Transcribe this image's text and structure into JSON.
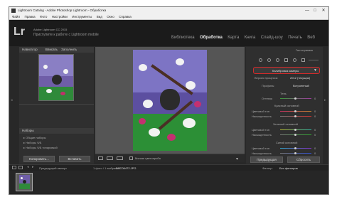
{
  "window": {
    "title": "Lightroom Catalog - Adobe Photoshop Lightroom - Обработка",
    "controls": [
      "—",
      "□",
      "✕"
    ]
  },
  "menu": [
    "Файл",
    "Правка",
    "Фото",
    "Настройки",
    "Инструменты",
    "Вид",
    "Окно",
    "Справка"
  ],
  "header": {
    "logo": "Lr",
    "line1": "Adobe Lightroom CC 2015",
    "line2": "Приступите к работе с Lightroom mobile",
    "modules": [
      "Библиотека",
      "Обработка",
      "Карта",
      "Книга",
      "Слайд-шоу",
      "Печать",
      "Веб"
    ],
    "active_module": "Обработка"
  },
  "left_panel": {
    "navigator_label": "Навигатор",
    "zoom_options": [
      "Вписать",
      "Заполнить"
    ],
    "presets_label": "Наборы",
    "presets": [
      "Общие наборы",
      "Наборы Ч/Б",
      "Наборы Ч/Б тонировкой"
    ],
    "copy_button": "Копировать...",
    "paste_button": "Вставить"
  },
  "toolbar": {
    "before_after": "Мягкая цветопроба"
  },
  "right_panel": {
    "histogram_label": "Гистограмма",
    "camera_calibration": "Калибровка камеры",
    "process_label": "Версия процесса:",
    "process_value": "2012 (текущая)",
    "profile_label": "Профиль:",
    "profile_value": "Встроенный",
    "shadows_label": "Тень",
    "tint_label": "Оттенок",
    "red_primary": "Красный основной",
    "green_primary": "Зеленый основной",
    "blue_primary": "Синий основной",
    "hue_label": "Цветовой тон",
    "saturation_label": "Насыщенность",
    "zero": "0",
    "previous_button": "Предыдущая",
    "reset_button": "Сбросить"
  },
  "filmstrip": {
    "source": "Предыдущий импорт",
    "counter": "1 фото / 1 выбрано /",
    "filename": "DSC06472.JPG",
    "filter_label": "Фильтр:",
    "filter_value": "Без фильтров"
  },
  "colors": {
    "highlight": "#d42a2a",
    "bg": "#282828",
    "panel": "#2f2f2f"
  }
}
